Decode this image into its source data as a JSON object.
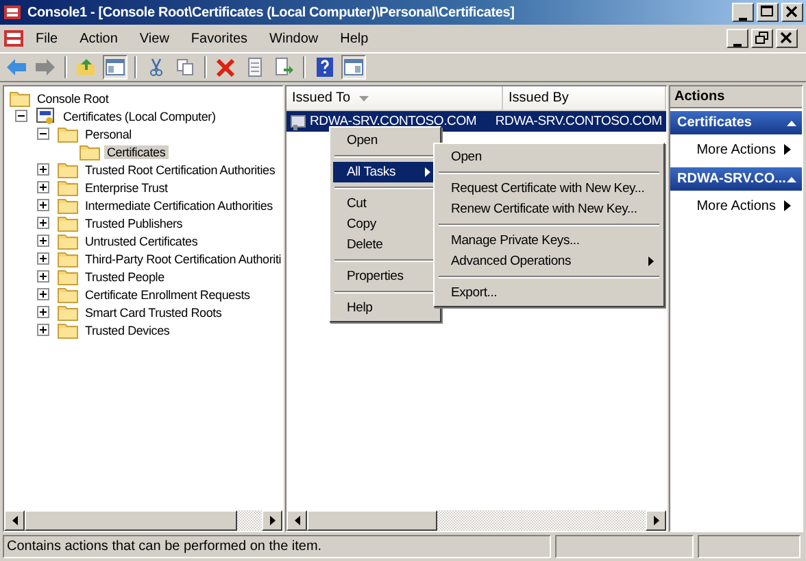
{
  "window": {
    "title": "Console1 - [Console Root\\Certificates (Local Computer)\\Personal\\Certificates]"
  },
  "menu_bar": [
    "File",
    "Action",
    "View",
    "Favorites",
    "Window",
    "Help"
  ],
  "tree": {
    "items": [
      {
        "label": "Console Root",
        "selected": false,
        "children": [
          {
            "label": "Certificates (Local Computer)",
            "expanded": true,
            "selected": false,
            "children": [
              {
                "label": "Personal",
                "expanded": true,
                "selected": false,
                "children": [
                  {
                    "label": "Certificates",
                    "selected": true
                  }
                ]
              },
              {
                "label": "Trusted Root Certification Authorities",
                "expanded": false,
                "selected": false
              },
              {
                "label": "Enterprise Trust",
                "expanded": false,
                "selected": false
              },
              {
                "label": "Intermediate Certification Authorities",
                "expanded": false,
                "selected": false
              },
              {
                "label": "Trusted Publishers",
                "expanded": false,
                "selected": false
              },
              {
                "label": "Untrusted Certificates",
                "expanded": false,
                "selected": false
              },
              {
                "label": "Third-Party Root Certification Authoriti",
                "expanded": false,
                "selected": false
              },
              {
                "label": "Trusted People",
                "expanded": false,
                "selected": false
              },
              {
                "label": "Certificate Enrollment Requests",
                "expanded": false,
                "selected": false
              },
              {
                "label": "Smart Card Trusted Roots",
                "expanded": false,
                "selected": false
              },
              {
                "label": "Trusted Devices",
                "expanded": false,
                "selected": false
              }
            ]
          }
        ]
      }
    ]
  },
  "list": {
    "columns": [
      {
        "label": "Issued To",
        "sorted": true
      },
      {
        "label": "Issued By",
        "sorted": false
      }
    ],
    "rows": [
      {
        "cells": [
          "RDWA-SRV.CONTOSO.COM",
          "RDWA-SRV.CONTOSO.COM"
        ],
        "selected": true
      }
    ]
  },
  "context_menu": {
    "items": [
      {
        "kind": "item",
        "label": "Open",
        "selected": false
      },
      {
        "kind": "separator"
      },
      {
        "kind": "submenu",
        "label": "All Tasks",
        "selected": true
      },
      {
        "kind": "separator"
      },
      {
        "kind": "item",
        "label": "Cut",
        "selected": false
      },
      {
        "kind": "item",
        "label": "Copy",
        "selected": false
      },
      {
        "kind": "item",
        "label": "Delete",
        "selected": false
      },
      {
        "kind": "separator"
      },
      {
        "kind": "item",
        "label": "Properties",
        "selected": false
      },
      {
        "kind": "separator"
      },
      {
        "kind": "item",
        "label": "Help",
        "selected": false
      }
    ]
  },
  "submenu": {
    "items": [
      {
        "kind": "item",
        "label": "Open",
        "selected": false
      },
      {
        "kind": "separator"
      },
      {
        "kind": "item",
        "label": "Request Certificate with New Key...",
        "selected": false
      },
      {
        "kind": "item",
        "label": "Renew Certificate with New Key...",
        "selected": false
      },
      {
        "kind": "separator"
      },
      {
        "kind": "item",
        "label": "Manage Private Keys...",
        "selected": false
      },
      {
        "kind": "submenu",
        "label": "Advanced Operations",
        "selected": false
      },
      {
        "kind": "separator"
      },
      {
        "kind": "item",
        "label": "Export...",
        "selected": false
      }
    ]
  },
  "actions": {
    "title": "Actions",
    "sections": [
      {
        "title": "Certificates",
        "items": [
          "More Actions"
        ]
      },
      {
        "title": "RDWA-SRV.CO...",
        "items": [
          "More Actions"
        ]
      }
    ]
  },
  "status_bar": {
    "text": "Contains actions that can be performed on the item."
  }
}
